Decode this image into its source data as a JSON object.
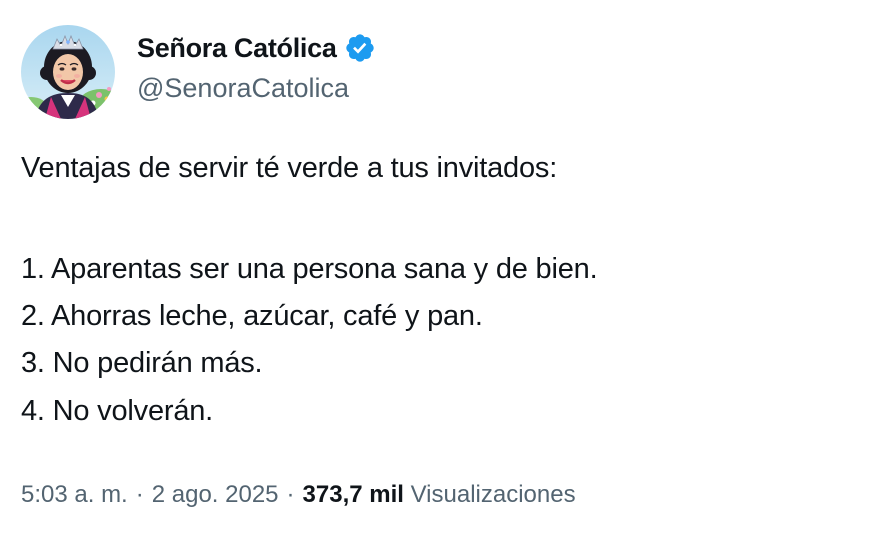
{
  "author": {
    "display_name": "Señora Católica",
    "handle": "@SenoraCatolica",
    "verified": true,
    "verified_color": "#1d9bf0"
  },
  "tweet": {
    "intro": "Ventajas de servir té verde a tus invitados:",
    "items": [
      "1. Aparentas ser una persona sana y de bien.",
      "2. Ahorras leche, azúcar, café y pan.",
      "3. No pedirán más.",
      "4. No volverán."
    ]
  },
  "meta": {
    "time": "5:03 a. m.",
    "separator": "·",
    "date": "2 ago. 2025",
    "views_count": "373,7 mil",
    "views_label": "Visualizaciones"
  },
  "colors": {
    "text_primary": "#0f1419",
    "text_secondary": "#536471"
  }
}
